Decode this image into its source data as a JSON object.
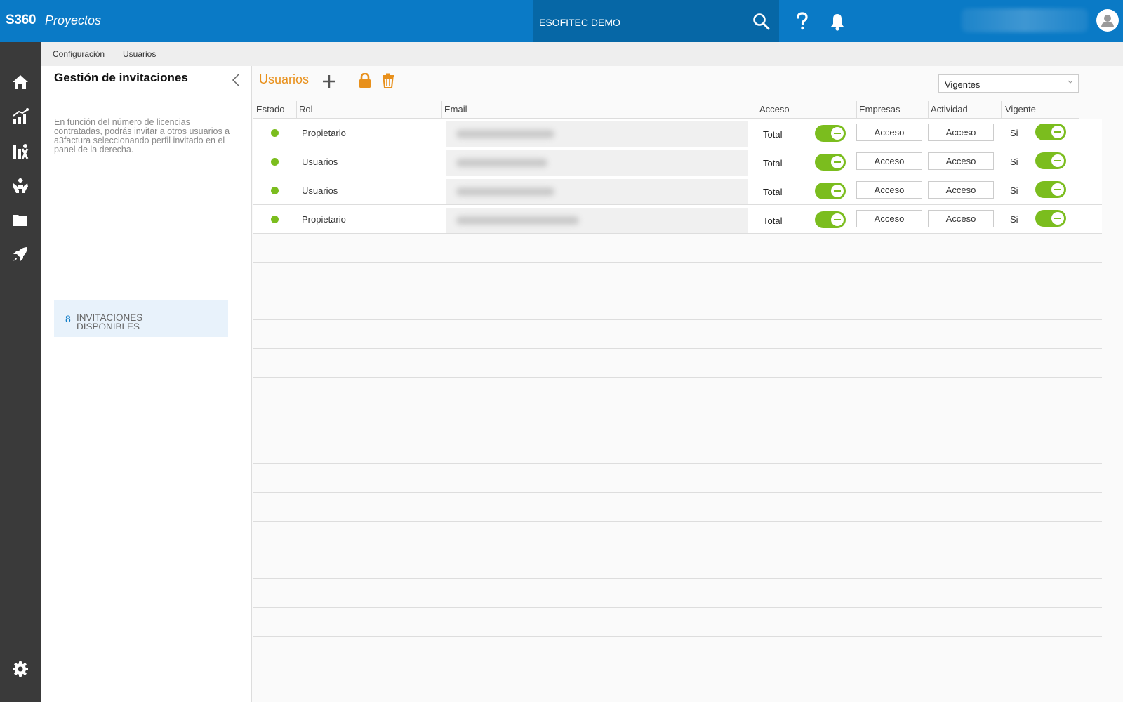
{
  "app": {
    "brand": "S360",
    "product": "Proyectos"
  },
  "header": {
    "company": "ESOFITEC DEMO"
  },
  "breadcrumb": [
    "Configuración",
    "Usuarios"
  ],
  "left_panel": {
    "title": "Gestión de invitaciones",
    "description": "En función del número de licencias contratadas, podrás invitar a otros usuarios a a3factura seleccionando perfil invitado en el panel de la derecha.",
    "invitations_count": "8",
    "invitations_label": "INVITACIONES DISPONIBLES"
  },
  "main": {
    "title": "Usuarios",
    "filter": {
      "value": "Vigentes"
    },
    "columns": [
      "Estado",
      "Rol",
      "Email",
      "Acceso",
      "Empresas",
      "Actividad",
      "Vigente"
    ],
    "rows": [
      {
        "role": "Propietario",
        "access": "Total",
        "empresas": "Acceso",
        "actividad": "Acceso",
        "vigente": "Si"
      },
      {
        "role": "Usuarios",
        "access": "Total",
        "empresas": "Acceso",
        "actividad": "Acceso",
        "vigente": "Si"
      },
      {
        "role": "Usuarios",
        "access": "Total",
        "empresas": "Acceso",
        "actividad": "Acceso",
        "vigente": "Si"
      },
      {
        "role": "Propietario",
        "access": "Total",
        "empresas": "Acceso",
        "actividad": "Acceso",
        "vigente": "Si"
      }
    ]
  },
  "colors": {
    "header_blue": "#0a7ac6",
    "accent_orange": "#e8901b",
    "status_green": "#7bbd1e",
    "nav_dark": "#3a3a3a"
  },
  "icons": {
    "header": [
      "search-icon",
      "help-icon",
      "bell-icon",
      "user-avatar-icon"
    ],
    "nav": [
      "home-icon",
      "chart-icon",
      "analytics-icon",
      "hands-icon",
      "folder-icon",
      "rocket-icon",
      "settings-icon"
    ],
    "toolbar": [
      "add-icon",
      "lock-icon",
      "trash-icon"
    ]
  }
}
